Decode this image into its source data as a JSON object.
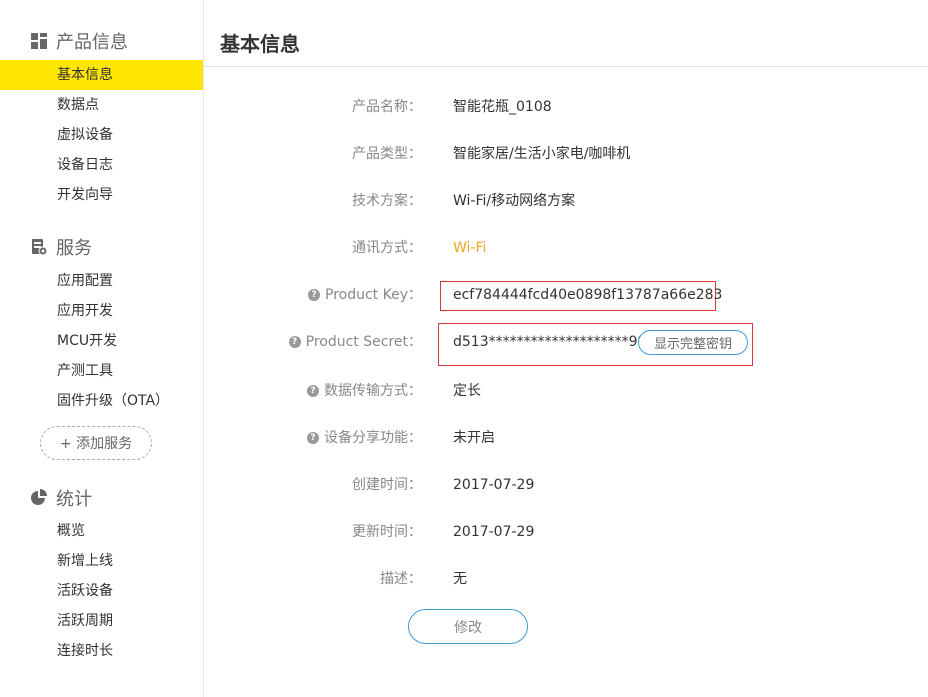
{
  "sidebar": {
    "sections": [
      {
        "title": "产品信息",
        "icon": "grid-icon",
        "items": [
          "基本信息",
          "数据点",
          "虚拟设备",
          "设备日志",
          "开发向导"
        ]
      },
      {
        "title": "服务",
        "icon": "server-icon",
        "items": [
          "应用配置",
          "应用开发",
          "MCU开发",
          "产测工具",
          "固件升级（OTA）"
        ]
      },
      {
        "title": "统计",
        "icon": "pie-chart-icon",
        "items": [
          "概览",
          "新增上线",
          "活跃设备",
          "活跃周期",
          "连接时长"
        ]
      }
    ],
    "add_service_label": "+ 添加服务",
    "active_color": "#ffe600"
  },
  "main": {
    "title": "基本信息",
    "fields": [
      {
        "label": "产品名称：",
        "value": "智能花瓶_0108"
      },
      {
        "label": "产品类型：",
        "value": "智能家居/生活小家电/咖啡机"
      },
      {
        "label": "技术方案：",
        "value": "Wi-Fi/移动网络方案"
      },
      {
        "label": "通讯方式：",
        "value": "Wi-Fi"
      },
      {
        "label": "Product Key：",
        "value": "ecf784444fcd40e0898f13787a66e283"
      },
      {
        "label": "Product Secret：",
        "value": "d513********************9913"
      },
      {
        "label": "数据传输方式：",
        "value": "定长"
      },
      {
        "label": "设备分享功能：",
        "value": "未开启"
      },
      {
        "label": "创建时间：",
        "value": "2017-07-29"
      },
      {
        "label": "更新时间：",
        "value": "2017-07-29"
      },
      {
        "label": "描述：",
        "value": "无"
      }
    ],
    "show_secret_label": "显示完整密钥",
    "modify_label": "修改",
    "help_glyph": "?"
  }
}
